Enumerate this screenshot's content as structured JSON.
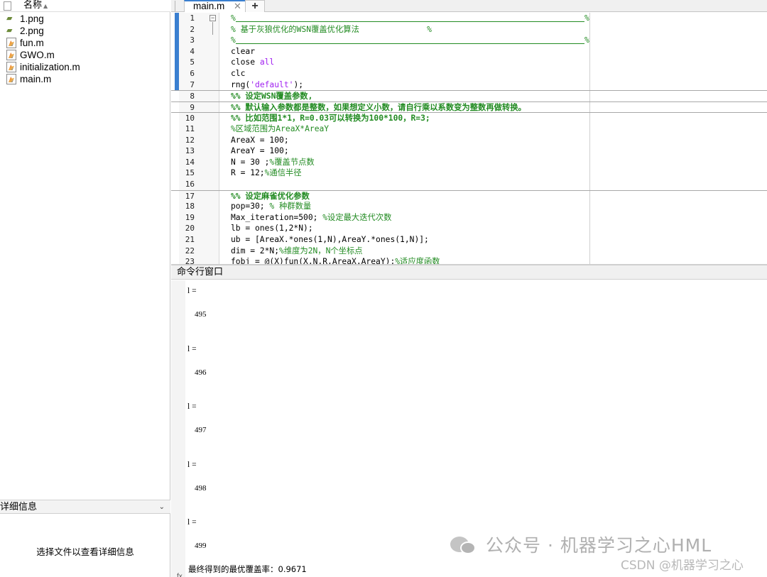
{
  "file_browser": {
    "column_name": "名称",
    "files": [
      {
        "name": "1.png",
        "type": "png"
      },
      {
        "name": "2.png",
        "type": "png"
      },
      {
        "name": "fun.m",
        "type": "m"
      },
      {
        "name": "GWO.m",
        "type": "m"
      },
      {
        "name": "initialization.m",
        "type": "m"
      },
      {
        "name": "main.m",
        "type": "m"
      }
    ],
    "details_title": "详细信息",
    "details_placeholder": "选择文件以查看详细信息"
  },
  "editor": {
    "active_tab": "main.m",
    "close_glyph": "✕",
    "add_glyph": "+",
    "lines": [
      {
        "n": "1",
        "parts": [
          {
            "t": "%",
            "c": "green"
          }
        ]
      },
      {
        "n": "2",
        "parts": [
          {
            "t": "% 基于灰狼优化的WSN覆盖优化算法              %",
            "c": "green"
          }
        ]
      },
      {
        "n": "3",
        "parts": [
          {
            "t": "%",
            "c": "green"
          }
        ]
      },
      {
        "n": "4",
        "parts": [
          {
            "t": "clear",
            "c": ""
          }
        ]
      },
      {
        "n": "5",
        "parts": [
          {
            "t": "close ",
            "c": ""
          },
          {
            "t": "all",
            "c": "purple"
          }
        ]
      },
      {
        "n": "6",
        "parts": [
          {
            "t": "clc",
            "c": ""
          }
        ]
      },
      {
        "n": "7",
        "parts": [
          {
            "t": "rng(",
            "c": ""
          },
          {
            "t": "'default'",
            "c": "purple"
          },
          {
            "t": ");",
            "c": ""
          }
        ]
      },
      {
        "n": "8",
        "parts": [
          {
            "t": "%% 设定WSN覆盖参数,",
            "c": "green-b"
          }
        ]
      },
      {
        "n": "9",
        "parts": [
          {
            "t": "%% 默认输入参数都是整数，如果想定义小数，请自行乘以系数变为整数再做转换。",
            "c": "green-b"
          }
        ]
      },
      {
        "n": "10",
        "parts": [
          {
            "t": "%% 比如范围1*1，R=0.03可以转换为100*100，R=3;",
            "c": "green-b"
          }
        ]
      },
      {
        "n": "11",
        "parts": [
          {
            "t": "%区域范围为AreaX*AreaY",
            "c": "green"
          }
        ]
      },
      {
        "n": "12",
        "parts": [
          {
            "t": "AreaX = 100;",
            "c": ""
          }
        ]
      },
      {
        "n": "13",
        "parts": [
          {
            "t": "AreaY = 100;",
            "c": ""
          }
        ]
      },
      {
        "n": "14",
        "parts": [
          {
            "t": "N = 30 ;",
            "c": ""
          },
          {
            "t": "%覆盖节点数",
            "c": "green"
          }
        ]
      },
      {
        "n": "15",
        "parts": [
          {
            "t": "R = 12;",
            "c": ""
          },
          {
            "t": "%通信半径",
            "c": "green"
          }
        ]
      },
      {
        "n": "16",
        "parts": []
      },
      {
        "n": "17",
        "parts": [
          {
            "t": "%% 设定麻雀优化参数",
            "c": "green-b"
          }
        ]
      },
      {
        "n": "18",
        "parts": [
          {
            "t": "pop=30; ",
            "c": ""
          },
          {
            "t": "% 种群数量",
            "c": "green"
          }
        ]
      },
      {
        "n": "19",
        "parts": [
          {
            "t": "Max_iteration=500; ",
            "c": ""
          },
          {
            "t": "%设定最大迭代次数",
            "c": "green"
          }
        ]
      },
      {
        "n": "20",
        "parts": [
          {
            "t": "lb = ones(1,2*N);",
            "c": ""
          }
        ]
      },
      {
        "n": "21",
        "parts": [
          {
            "t": "ub = [AreaX.*ones(1,N),AreaY.*ones(1,N)];",
            "c": ""
          }
        ]
      },
      {
        "n": "22",
        "parts": [
          {
            "t": "dim = 2*N;",
            "c": ""
          },
          {
            "t": "%维度为2N，N个坐标点",
            "c": "green"
          }
        ]
      },
      {
        "n": "23",
        "parts": [
          {
            "t": "fobj = @(X)fun(X,N,R,AreaX,AreaY);",
            "c": ""
          },
          {
            "t": "%适应度函数",
            "c": "green"
          }
        ]
      }
    ]
  },
  "command_window": {
    "title": "命令行窗口",
    "outputs": [
      {
        "label": "l =",
        "value": "495"
      },
      {
        "label": "l =",
        "value": "496"
      },
      {
        "label": "l =",
        "value": "497"
      },
      {
        "label": "l =",
        "value": "498"
      },
      {
        "label": "l =",
        "value": "499"
      }
    ],
    "final_text": "最终得到的最优覆盖率：0.9671",
    "prompt": "fx"
  },
  "watermarks": {
    "wechat": "公众号 · 机器学习之心HML",
    "csdn": "CSDN @机器学习之心"
  }
}
